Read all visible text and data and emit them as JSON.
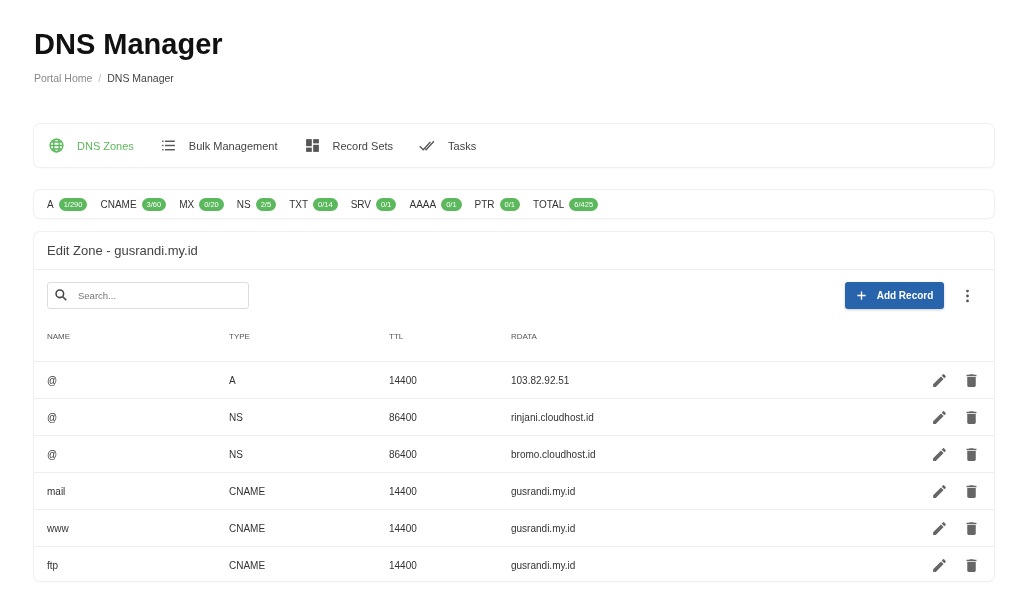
{
  "page_title": "DNS Manager",
  "breadcrumb_separator": "/",
  "breadcrumb": [
    {
      "label": "Portal Home",
      "current": false
    },
    {
      "label": "DNS Manager",
      "current": true
    }
  ],
  "tabs": [
    {
      "label": "DNS Zones",
      "kind": "globe",
      "selected": true
    },
    {
      "label": "Bulk Management",
      "kind": "list",
      "selected": false
    },
    {
      "label": "Record Sets",
      "kind": "grid",
      "selected": false
    },
    {
      "label": "Tasks",
      "kind": "checks",
      "selected": false
    }
  ],
  "record_counts": [
    {
      "type": "A",
      "count": "1/290"
    },
    {
      "type": "CNAME",
      "count": "3/60"
    },
    {
      "type": "MX",
      "count": "0/20"
    },
    {
      "type": "NS",
      "count": "2/5"
    },
    {
      "type": "TXT",
      "count": "0/14"
    },
    {
      "type": "SRV",
      "count": "0/1"
    },
    {
      "type": "AAAA",
      "count": "0/1"
    },
    {
      "type": "PTR",
      "count": "0/1"
    },
    {
      "type": "TOTAL",
      "count": "6/425"
    }
  ],
  "zone_panel": {
    "title": "Edit Zone - gusrandi.my.id",
    "search": {
      "placeholder": "Search..."
    },
    "add_button": "Add Record",
    "table": {
      "columns": [
        "NAME",
        "TYPE",
        "TTL",
        "RDATA"
      ],
      "rows": [
        {
          "name": "@",
          "type": "A",
          "ttl": "14400",
          "rdata": "103.82.92.51"
        },
        {
          "name": "@",
          "type": "NS",
          "ttl": "86400",
          "rdata": "rinjani.cloudhost.id"
        },
        {
          "name": "@",
          "type": "NS",
          "ttl": "86400",
          "rdata": "bromo.cloudhost.id"
        },
        {
          "name": "mail",
          "type": "CNAME",
          "ttl": "14400",
          "rdata": "gusrandi.my.id"
        },
        {
          "name": "www",
          "type": "CNAME",
          "ttl": "14400",
          "rdata": "gusrandi.my.id"
        },
        {
          "name": "ftp",
          "type": "CNAME",
          "ttl": "14400",
          "rdata": "gusrandi.my.id"
        }
      ]
    }
  }
}
